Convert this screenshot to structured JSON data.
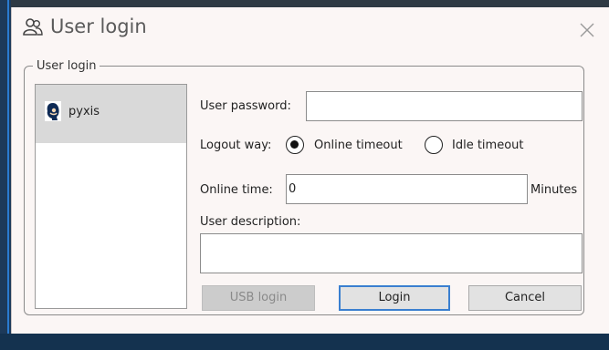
{
  "window": {
    "title": "User login",
    "icon": "users-icon",
    "close_icon": "close-icon"
  },
  "group": {
    "legend": "User login"
  },
  "user_list": {
    "items": [
      {
        "name": "pyxis",
        "icon": "user-avatar-icon",
        "selected": true
      }
    ]
  },
  "form": {
    "password_label": "User password:",
    "password_value": "",
    "logout_label": "Logout way:",
    "logout_options": [
      {
        "label": "Online timeout",
        "checked": true
      },
      {
        "label": "Idle timeout",
        "checked": false
      }
    ],
    "online_time_label": "Online time:",
    "online_time_value": "0",
    "online_time_unit": "Minutes",
    "description_label": "User description:",
    "description_value": ""
  },
  "buttons": {
    "usb_login": "USB login",
    "login": "Login",
    "cancel": "Cancel"
  },
  "colors": {
    "dialog_bg": "#fbf6f5",
    "selected_item_bg": "#d9d9d9",
    "primary_border": "#3a7fd0",
    "disabled_bg": "#cccccc"
  }
}
